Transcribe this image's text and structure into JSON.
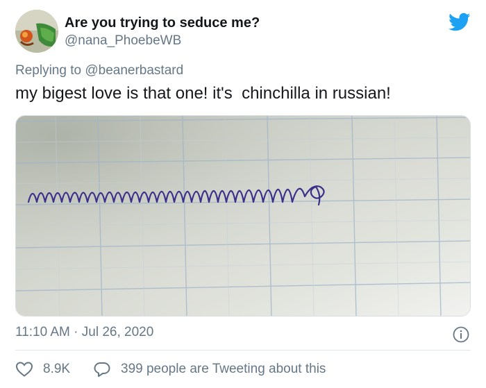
{
  "author": {
    "display_name": "Are you trying to seduce me?",
    "handle": "@nana_PhoebeWB"
  },
  "reply": {
    "prefix": "Replying to",
    "mention": "@beanerbastard"
  },
  "tweet": {
    "text": "my bigest love is that one! it's  chinchilla in russian!",
    "timestamp": "11:10 AM · Jul 26, 2020"
  },
  "photo": {
    "description_icon": "handwriting-photo"
  },
  "stats": {
    "likes": "8.9K",
    "tweeting": "399 people are Tweeting about this"
  },
  "colors": {
    "twitter_blue": "#1da1f2",
    "secondary_text": "#657786",
    "ink": "#3a2f8a"
  },
  "icons": {
    "logo": "twitter-bird-icon",
    "info": "info-icon",
    "like": "heart-icon",
    "comment": "speech-bubble-icon"
  }
}
